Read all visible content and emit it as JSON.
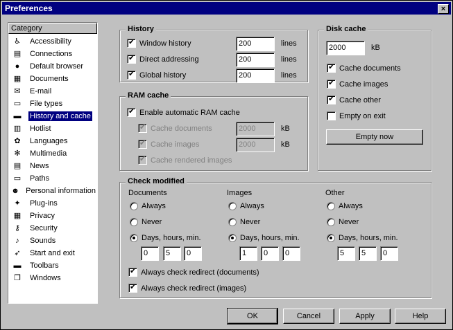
{
  "window": {
    "title": "Preferences",
    "close_glyph": "×"
  },
  "sidebar": {
    "header": "Category",
    "items": [
      {
        "label": "Accessibility",
        "icon": "accessibility-icon",
        "glyph": "♿"
      },
      {
        "label": "Connections",
        "icon": "connections-icon",
        "glyph": "▤"
      },
      {
        "label": "Default browser",
        "icon": "default-browser-icon",
        "glyph": "●"
      },
      {
        "label": "Documents",
        "icon": "documents-icon",
        "glyph": "▦"
      },
      {
        "label": "E-mail",
        "icon": "email-icon",
        "glyph": "✉"
      },
      {
        "label": "File types",
        "icon": "file-types-icon",
        "glyph": "▭"
      },
      {
        "label": "History and cache",
        "icon": "history-cache-icon",
        "glyph": "▬"
      },
      {
        "label": "Hotlist",
        "icon": "hotlist-icon",
        "glyph": "▥"
      },
      {
        "label": "Languages",
        "icon": "languages-icon",
        "glyph": "✿"
      },
      {
        "label": "Multimedia",
        "icon": "multimedia-icon",
        "glyph": "✻"
      },
      {
        "label": "News",
        "icon": "news-icon",
        "glyph": "▤"
      },
      {
        "label": "Paths",
        "icon": "paths-icon",
        "glyph": "▭"
      },
      {
        "label": "Personal information",
        "icon": "personal-info-icon",
        "glyph": "☻"
      },
      {
        "label": "Plug-ins",
        "icon": "plugins-icon",
        "glyph": "✦"
      },
      {
        "label": "Privacy",
        "icon": "privacy-icon",
        "glyph": "▦"
      },
      {
        "label": "Security",
        "icon": "security-icon",
        "glyph": "⚷"
      },
      {
        "label": "Sounds",
        "icon": "sounds-icon",
        "glyph": "♪"
      },
      {
        "label": "Start and exit",
        "icon": "start-exit-icon",
        "glyph": "➶"
      },
      {
        "label": "Toolbars",
        "icon": "toolbars-icon",
        "glyph": "▬"
      },
      {
        "label": "Windows",
        "icon": "windows-icon",
        "glyph": "❐"
      }
    ]
  },
  "history": {
    "title": "History",
    "window_history": {
      "label": "Window history",
      "value": "200",
      "unit": "lines",
      "checked": true
    },
    "direct_addressing": {
      "label": "Direct addressing",
      "value": "200",
      "unit": "lines",
      "checked": true
    },
    "global_history": {
      "label": "Global history",
      "value": "200",
      "unit": "lines",
      "checked": true
    }
  },
  "disk_cache": {
    "title": "Disk cache",
    "size": "2000",
    "unit": "kB",
    "cache_documents": "Cache documents",
    "cache_images": "Cache images",
    "cache_other": "Cache other",
    "empty_on_exit": "Empty on exit",
    "empty_now": "Empty now"
  },
  "ram_cache": {
    "title": "RAM cache",
    "enable_auto": "Enable automatic RAM cache",
    "cache_documents": {
      "label": "Cache documents",
      "value": "2000",
      "unit": "kB"
    },
    "cache_images": {
      "label": "Cache images",
      "value": "2000",
      "unit": "kB"
    },
    "cache_rendered": "Cache rendered images"
  },
  "check_modified": {
    "title": "Check modified",
    "always": "Always",
    "never": "Never",
    "days": "Days, hours, min.",
    "documents": {
      "title": "Documents",
      "d": "0",
      "h": "5",
      "m": "0"
    },
    "images": {
      "title": "Images",
      "d": "1",
      "h": "0",
      "m": "0"
    },
    "other": {
      "title": "Other",
      "d": "5",
      "h": "5",
      "m": "0"
    },
    "redirect_documents": "Always check redirect (documents)",
    "redirect_images": "Always check redirect (images)"
  },
  "buttons": {
    "ok": "OK",
    "cancel": "Cancel",
    "apply": "Apply",
    "help": "Help"
  }
}
